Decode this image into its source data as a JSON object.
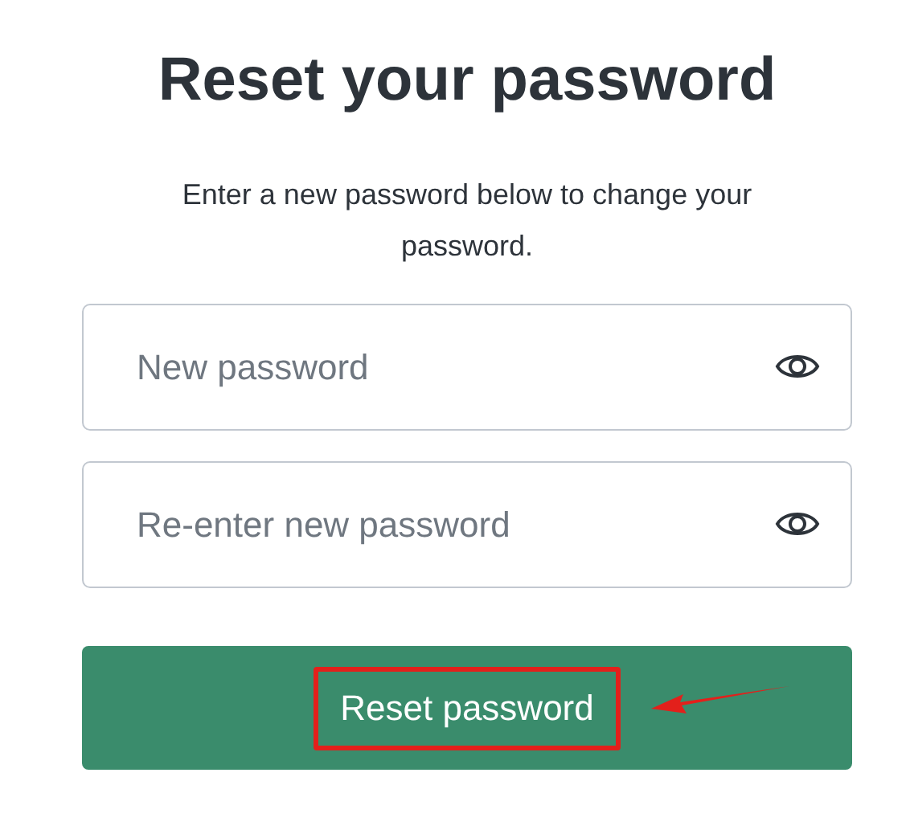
{
  "title": "Reset your password",
  "subtitle": "Enter a new password below to change your password.",
  "fields": [
    {
      "placeholder": "New password"
    },
    {
      "placeholder": "Re-enter new password"
    }
  ],
  "button": {
    "label": "Reset password",
    "highlighted": true
  }
}
